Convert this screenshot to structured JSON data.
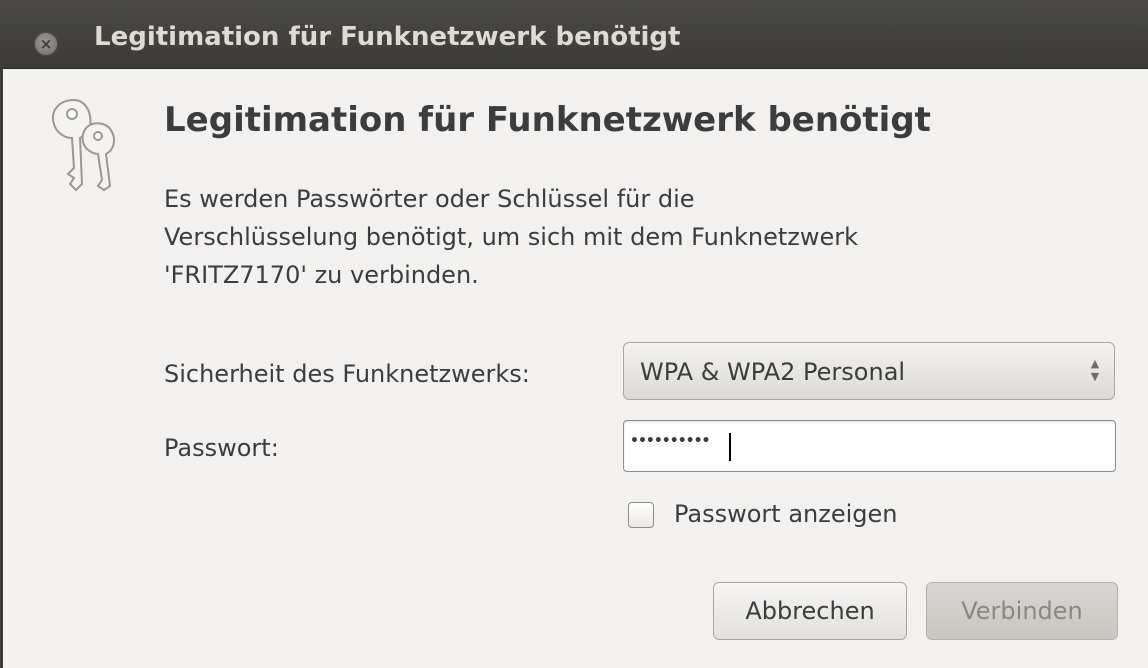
{
  "window": {
    "title": "Legitimation für Funknetzwerk benötigt",
    "close_icon": "close-icon"
  },
  "dialog": {
    "icon": "keys-icon",
    "heading": "Legitimation für Funknetzwerk benötigt",
    "message": "Es werden Passwörter oder Schlüssel für die\nVerschlüsselung benötigt, um sich mit dem Funknetzwerk\n'FRITZ7170' zu verbinden."
  },
  "form": {
    "security_label": "Sicherheit des Funknetzwerks:",
    "security_value": "WPA & WPA2 Personal",
    "password_label": "Passwort:",
    "password_masked": "••••••••••",
    "show_password_label": "Passwort anzeigen",
    "show_password_checked": false
  },
  "buttons": {
    "cancel": "Abbrechen",
    "connect": "Verbinden"
  }
}
